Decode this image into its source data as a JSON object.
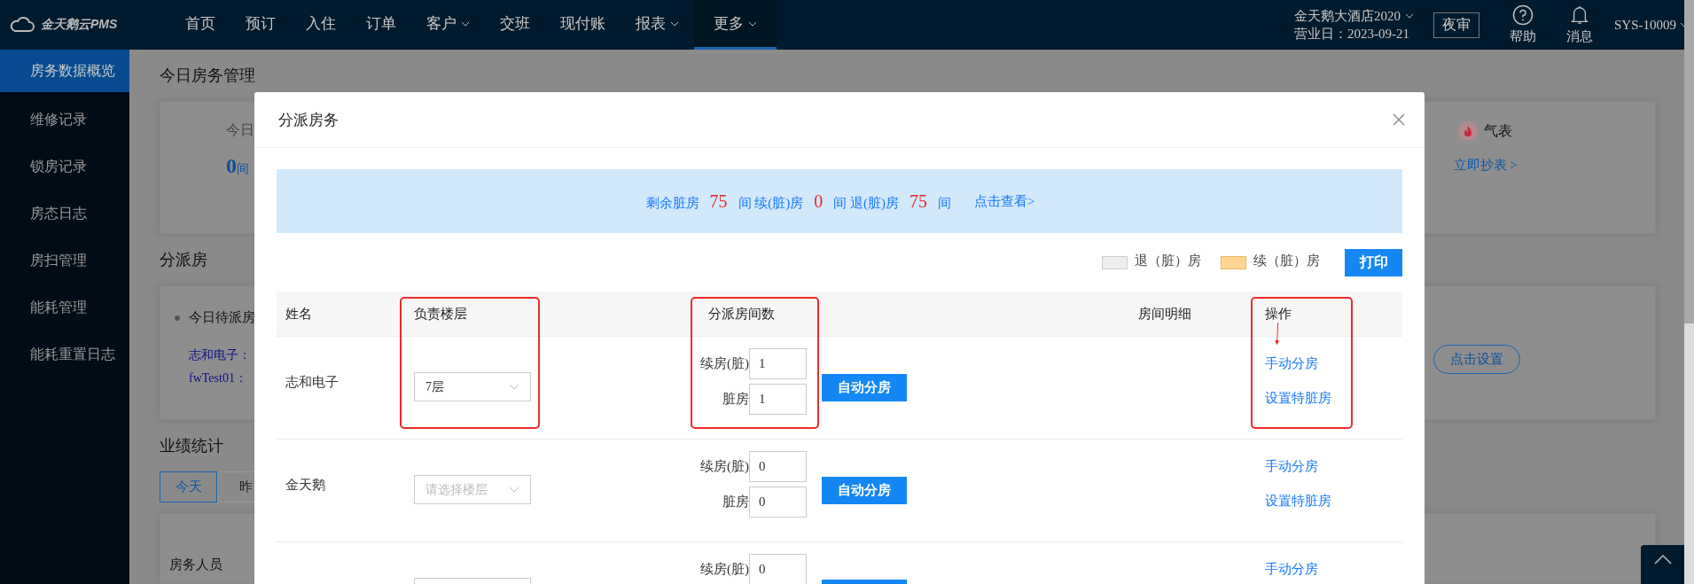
{
  "topbar": {
    "logo": "金天鹅云PMS",
    "nav": [
      {
        "label": "首页",
        "dropdown": false,
        "selected": false
      },
      {
        "label": "预订",
        "dropdown": false,
        "selected": false
      },
      {
        "label": "入住",
        "dropdown": false,
        "selected": false
      },
      {
        "label": "订单",
        "dropdown": false,
        "selected": false
      },
      {
        "label": "客户",
        "dropdown": true,
        "selected": false
      },
      {
        "label": "交班",
        "dropdown": false,
        "selected": false
      },
      {
        "label": "现付账",
        "dropdown": false,
        "selected": false
      },
      {
        "label": "报表",
        "dropdown": true,
        "selected": false
      },
      {
        "label": "更多",
        "dropdown": true,
        "selected": true
      }
    ],
    "hotel": "金天鹅大酒店2020",
    "business_date": "营业日：2023-09-21",
    "night_audit": "夜审",
    "help": "帮助",
    "messages": "消息",
    "user": "SYS-10009"
  },
  "sidebar": {
    "items": [
      {
        "label": "房务数据概览",
        "selected": true
      },
      {
        "label": "维修记录",
        "selected": false
      },
      {
        "label": "锁房记录",
        "selected": false
      },
      {
        "label": "房态日志",
        "selected": false
      },
      {
        "label": "房扫管理",
        "selected": false
      },
      {
        "label": "能耗管理",
        "selected": false
      },
      {
        "label": "能耗重置日志",
        "selected": false
      }
    ]
  },
  "page": {
    "overview_title": "今日房务管理",
    "overview_card": {
      "label": "今日",
      "count": "0",
      "unit": "间",
      "meter_label": "气表",
      "meter_link": "立即抄表 >"
    },
    "assign_title": "分派房",
    "assign_card": {
      "pending": "今日待派房",
      "staff": [
        "志和电子：",
        "fwTest01："
      ],
      "setup_button": "点击设置"
    },
    "stats_title": "业绩统计",
    "stats_tabs": [
      {
        "label": "今天",
        "selected": true
      },
      {
        "label": "昨",
        "selected": false
      }
    ],
    "stats_card": {
      "column_1": "房务人员"
    }
  },
  "dialog": {
    "title": "分派房务",
    "summary": [
      {
        "kind": "text",
        "text": "剩余脏房"
      },
      {
        "kind": "number",
        "text": "75"
      },
      {
        "kind": "text",
        "text": "间 续(脏)房"
      },
      {
        "kind": "number",
        "text": "0"
      },
      {
        "kind": "text",
        "text": "间 退(脏)房"
      },
      {
        "kind": "number",
        "text": "75"
      },
      {
        "kind": "text",
        "text": "间"
      }
    ],
    "view_link": "点击查看>",
    "legend": [
      {
        "label": "退（脏）房",
        "color": "#eeeeee"
      },
      {
        "label": "续（脏）房",
        "color": "#ffd591"
      }
    ],
    "print_button": "打印",
    "table": {
      "columns": [
        {
          "label": "姓名",
          "highlighted": false
        },
        {
          "label": "负责楼层",
          "highlighted": true
        },
        {
          "label": "分派房间数",
          "highlighted": true
        },
        {
          "label": "房间明细",
          "highlighted": false
        },
        {
          "label": "操作",
          "highlighted": true
        }
      ],
      "rows": [
        {
          "name": "志和电子",
          "floor": {
            "value": "7层"
          },
          "renewal_label": "续房(脏)",
          "renewal": "1",
          "dirty_label": "脏房",
          "dirty": "1",
          "auto_button": "自动分房",
          "actions": [
            "手动分房",
            "设置特脏房"
          ]
        },
        {
          "name": "金天鹅",
          "floor": {
            "placeholder": "请选择楼层"
          },
          "renewal_label": "续房(脏)",
          "renewal": "0",
          "dirty_label": "脏房",
          "dirty": "0",
          "auto_button": "自动分房",
          "actions": [
            "手动分房",
            "设置特脏房"
          ]
        },
        {
          "floor": {},
          "renewal_label": "续房(脏)",
          "renewal": "0",
          "actions": [
            "手动分房"
          ]
        }
      ]
    }
  }
}
